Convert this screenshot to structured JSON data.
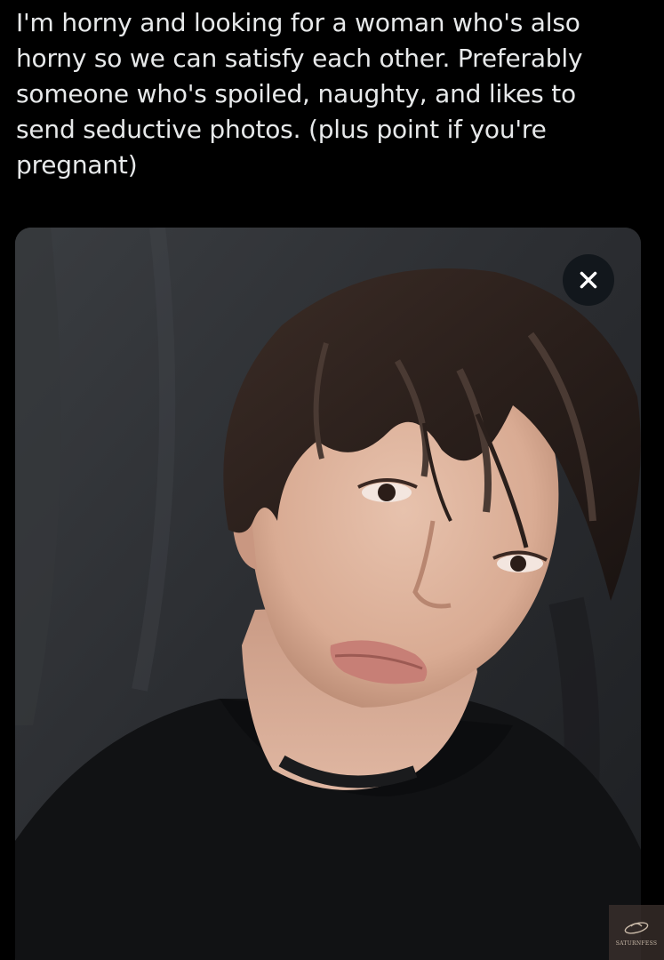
{
  "post": {
    "text_lines": [
      "I'm horny and looking for a woman who's also",
      "horny so we can satisfy each other. Preferably",
      "someone who's spoiled, naughty, and likes to",
      "send seductive photos. (plus point if you're",
      "pregnant)"
    ]
  },
  "media": {
    "type": "photo",
    "close_icon": "close-icon",
    "subject": "selfie of a man with wavy dark-brown hair wearing a black t-shirt against a dark draped backdrop"
  },
  "watermark": {
    "text": "SATURNFESS",
    "icon": "saturn-ring-icon"
  },
  "colors": {
    "background": "#000000",
    "text": "#e7e9ea",
    "close_button_bg": "#0f1419"
  }
}
